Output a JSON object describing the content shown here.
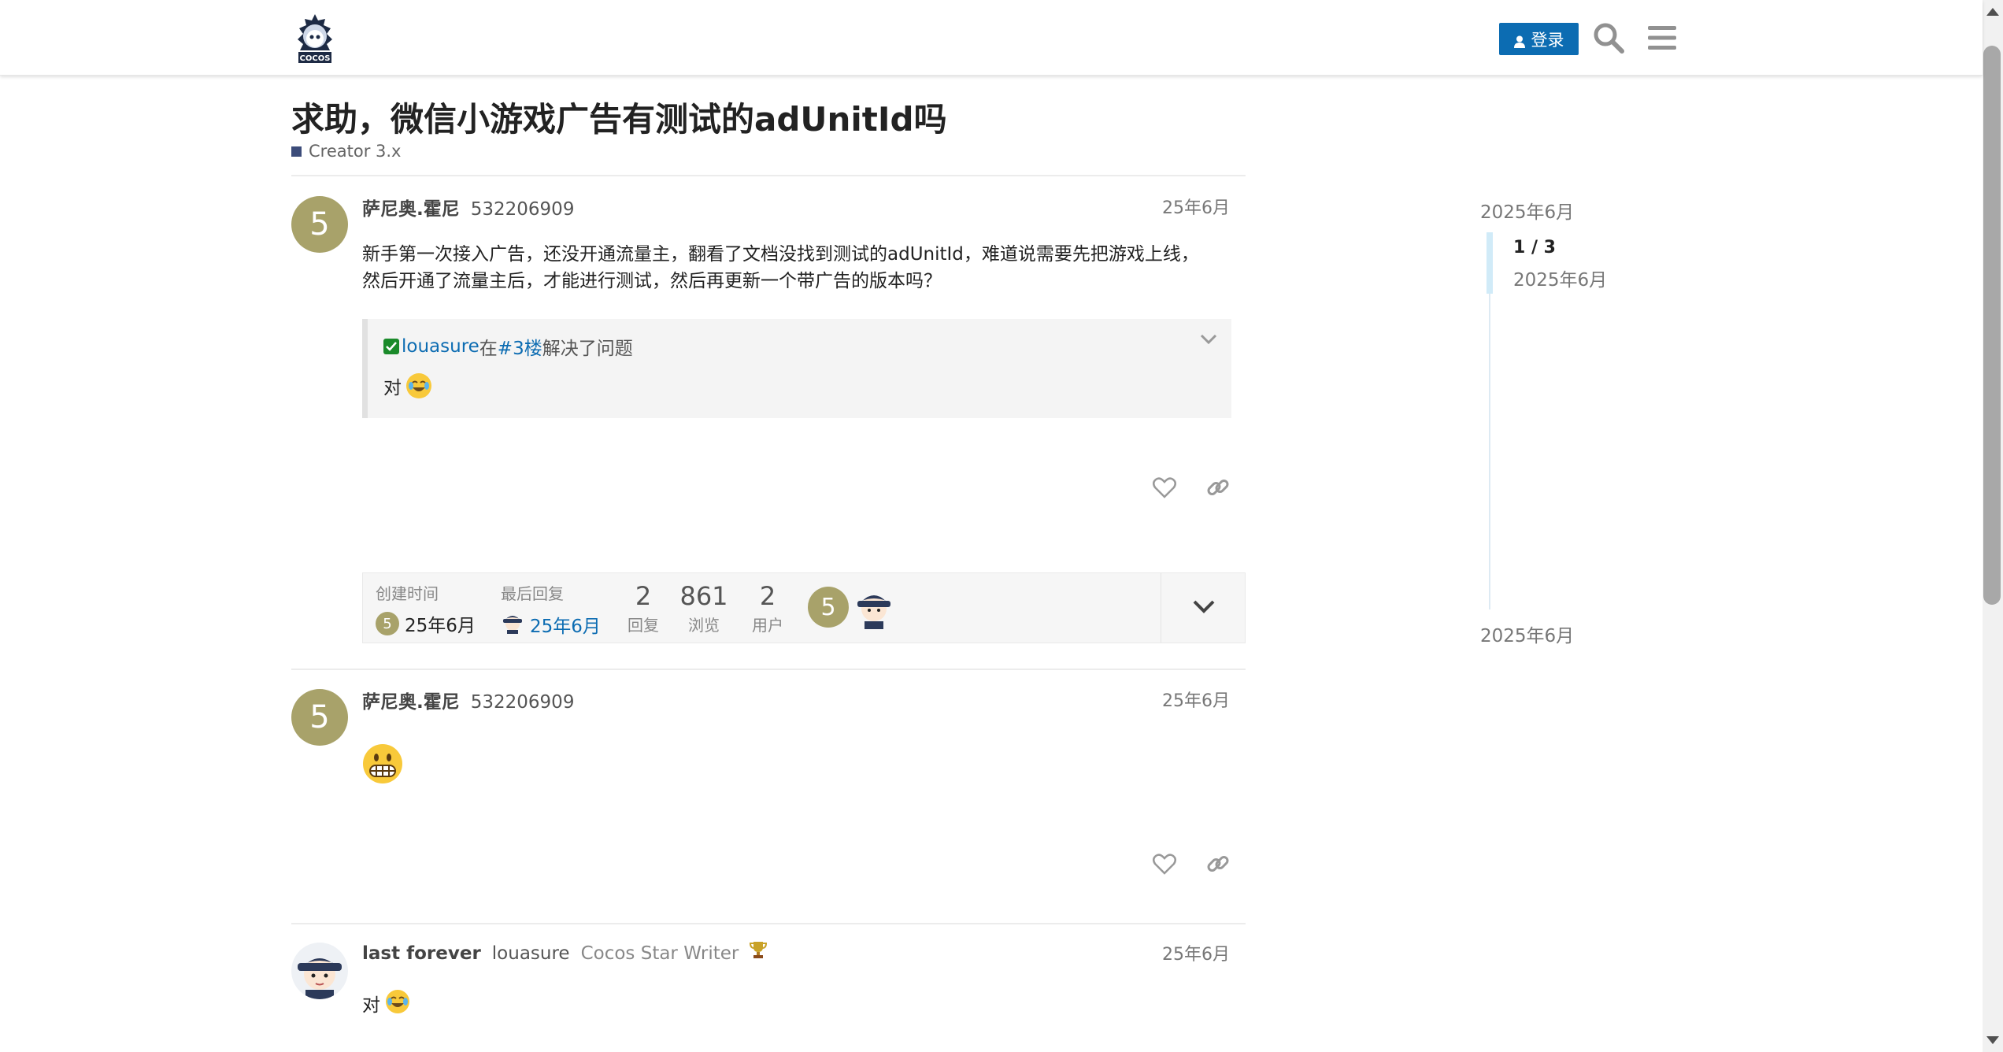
{
  "header": {
    "logo_text": "COCOS",
    "login_label": "登录",
    "icons": [
      "person-icon",
      "search-icon",
      "hamburger-menu-icon"
    ]
  },
  "topic": {
    "title": "求助，微信小游戏广告有测试的adUnitId吗",
    "category": "Creator 3.x",
    "category_color": "#3c4c7a"
  },
  "posts": [
    {
      "avatar_letter": "5",
      "name": "萨尼奥.霍尼",
      "username": "532206909",
      "date": "25年6月",
      "body_line1": "新手第一次接入广告，还没开通流量主，翻看了文档没找到测试的adUnitId，难道说需要先把游戏上线，",
      "body_line2": "然后开通了流量主后，才能进行测试，然后再更新一个带广告的版本吗？",
      "solution": {
        "user": "louasure",
        "text_in": "在",
        "post_ref": "#3楼",
        "text_solved": "解决了问题",
        "quote": "对"
      }
    },
    {
      "avatar_letter": "5",
      "name": "萨尼奥.霍尼",
      "username": "532206909",
      "date": "25年6月"
    },
    {
      "name": "last forever",
      "username": "louasure",
      "user_title": "Cocos Star Writer",
      "date": "25年6月",
      "body": "对"
    }
  ],
  "topic_map": {
    "created_label": "创建时间",
    "created_avatar": "5",
    "created_date": "25年6月",
    "last_reply_label": "最后回复",
    "last_reply_date": "25年6月",
    "replies": "2",
    "replies_label": "回复",
    "views": "861",
    "views_label": "浏览",
    "users": "2",
    "users_label": "用户",
    "participant_avatar": "5"
  },
  "timeline": {
    "start_date": "2025年6月",
    "position": "1 / 3",
    "position_date": "2025年6月",
    "end_date": "2025年6月"
  },
  "colors": {
    "accent": "#0c6cb2",
    "avatar_bg": "#a8a26a",
    "solved_green": "#1a8a2a"
  }
}
